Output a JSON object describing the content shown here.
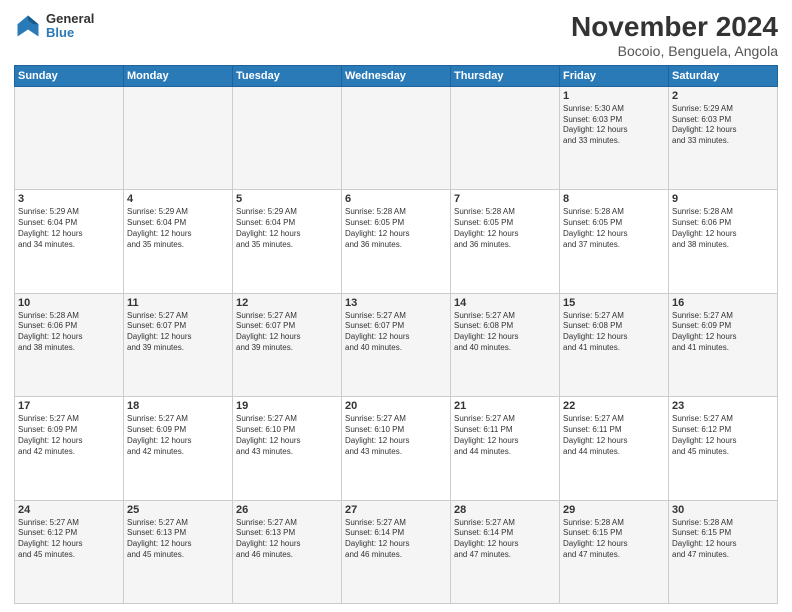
{
  "header": {
    "logo_general": "General",
    "logo_blue": "Blue",
    "title": "November 2024",
    "subtitle": "Bocoio, Benguela, Angola"
  },
  "weekdays": [
    "Sunday",
    "Monday",
    "Tuesday",
    "Wednesday",
    "Thursday",
    "Friday",
    "Saturday"
  ],
  "weeks": [
    [
      {
        "day": "",
        "info": ""
      },
      {
        "day": "",
        "info": ""
      },
      {
        "day": "",
        "info": ""
      },
      {
        "day": "",
        "info": ""
      },
      {
        "day": "",
        "info": ""
      },
      {
        "day": "1",
        "info": "Sunrise: 5:30 AM\nSunset: 6:03 PM\nDaylight: 12 hours\nand 33 minutes."
      },
      {
        "day": "2",
        "info": "Sunrise: 5:29 AM\nSunset: 6:03 PM\nDaylight: 12 hours\nand 33 minutes."
      }
    ],
    [
      {
        "day": "3",
        "info": "Sunrise: 5:29 AM\nSunset: 6:04 PM\nDaylight: 12 hours\nand 34 minutes."
      },
      {
        "day": "4",
        "info": "Sunrise: 5:29 AM\nSunset: 6:04 PM\nDaylight: 12 hours\nand 35 minutes."
      },
      {
        "day": "5",
        "info": "Sunrise: 5:29 AM\nSunset: 6:04 PM\nDaylight: 12 hours\nand 35 minutes."
      },
      {
        "day": "6",
        "info": "Sunrise: 5:28 AM\nSunset: 6:05 PM\nDaylight: 12 hours\nand 36 minutes."
      },
      {
        "day": "7",
        "info": "Sunrise: 5:28 AM\nSunset: 6:05 PM\nDaylight: 12 hours\nand 36 minutes."
      },
      {
        "day": "8",
        "info": "Sunrise: 5:28 AM\nSunset: 6:05 PM\nDaylight: 12 hours\nand 37 minutes."
      },
      {
        "day": "9",
        "info": "Sunrise: 5:28 AM\nSunset: 6:06 PM\nDaylight: 12 hours\nand 38 minutes."
      }
    ],
    [
      {
        "day": "10",
        "info": "Sunrise: 5:28 AM\nSunset: 6:06 PM\nDaylight: 12 hours\nand 38 minutes."
      },
      {
        "day": "11",
        "info": "Sunrise: 5:27 AM\nSunset: 6:07 PM\nDaylight: 12 hours\nand 39 minutes."
      },
      {
        "day": "12",
        "info": "Sunrise: 5:27 AM\nSunset: 6:07 PM\nDaylight: 12 hours\nand 39 minutes."
      },
      {
        "day": "13",
        "info": "Sunrise: 5:27 AM\nSunset: 6:07 PM\nDaylight: 12 hours\nand 40 minutes."
      },
      {
        "day": "14",
        "info": "Sunrise: 5:27 AM\nSunset: 6:08 PM\nDaylight: 12 hours\nand 40 minutes."
      },
      {
        "day": "15",
        "info": "Sunrise: 5:27 AM\nSunset: 6:08 PM\nDaylight: 12 hours\nand 41 minutes."
      },
      {
        "day": "16",
        "info": "Sunrise: 5:27 AM\nSunset: 6:09 PM\nDaylight: 12 hours\nand 41 minutes."
      }
    ],
    [
      {
        "day": "17",
        "info": "Sunrise: 5:27 AM\nSunset: 6:09 PM\nDaylight: 12 hours\nand 42 minutes."
      },
      {
        "day": "18",
        "info": "Sunrise: 5:27 AM\nSunset: 6:09 PM\nDaylight: 12 hours\nand 42 minutes."
      },
      {
        "day": "19",
        "info": "Sunrise: 5:27 AM\nSunset: 6:10 PM\nDaylight: 12 hours\nand 43 minutes."
      },
      {
        "day": "20",
        "info": "Sunrise: 5:27 AM\nSunset: 6:10 PM\nDaylight: 12 hours\nand 43 minutes."
      },
      {
        "day": "21",
        "info": "Sunrise: 5:27 AM\nSunset: 6:11 PM\nDaylight: 12 hours\nand 44 minutes."
      },
      {
        "day": "22",
        "info": "Sunrise: 5:27 AM\nSunset: 6:11 PM\nDaylight: 12 hours\nand 44 minutes."
      },
      {
        "day": "23",
        "info": "Sunrise: 5:27 AM\nSunset: 6:12 PM\nDaylight: 12 hours\nand 45 minutes."
      }
    ],
    [
      {
        "day": "24",
        "info": "Sunrise: 5:27 AM\nSunset: 6:12 PM\nDaylight: 12 hours\nand 45 minutes."
      },
      {
        "day": "25",
        "info": "Sunrise: 5:27 AM\nSunset: 6:13 PM\nDaylight: 12 hours\nand 45 minutes."
      },
      {
        "day": "26",
        "info": "Sunrise: 5:27 AM\nSunset: 6:13 PM\nDaylight: 12 hours\nand 46 minutes."
      },
      {
        "day": "27",
        "info": "Sunrise: 5:27 AM\nSunset: 6:14 PM\nDaylight: 12 hours\nand 46 minutes."
      },
      {
        "day": "28",
        "info": "Sunrise: 5:27 AM\nSunset: 6:14 PM\nDaylight: 12 hours\nand 47 minutes."
      },
      {
        "day": "29",
        "info": "Sunrise: 5:28 AM\nSunset: 6:15 PM\nDaylight: 12 hours\nand 47 minutes."
      },
      {
        "day": "30",
        "info": "Sunrise: 5:28 AM\nSunset: 6:15 PM\nDaylight: 12 hours\nand 47 minutes."
      }
    ]
  ]
}
